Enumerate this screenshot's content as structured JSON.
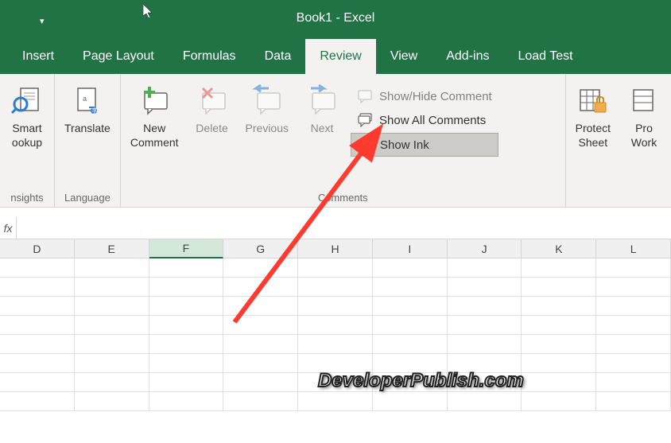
{
  "titlebar": {
    "title": "Book1  -  Excel"
  },
  "tabs": {
    "items": [
      {
        "label": "Insert"
      },
      {
        "label": "Page Layout"
      },
      {
        "label": "Formulas"
      },
      {
        "label": "Data"
      },
      {
        "label": "Review"
      },
      {
        "label": "View"
      },
      {
        "label": "Add-ins"
      },
      {
        "label": "Load Test"
      }
    ],
    "active_index": 4
  },
  "ribbon": {
    "groups": {
      "insights": {
        "label": "nsights",
        "smart_lookup": "Smart\nookup"
      },
      "language": {
        "label": "Language",
        "translate": "Translate"
      },
      "comments": {
        "label": "Comments",
        "new_comment": "New\nComment",
        "delete": "Delete",
        "previous": "Previous",
        "next": "Next",
        "show_hide": "Show/Hide Comment",
        "show_all": "Show All Comments",
        "show_ink": "Show Ink"
      },
      "changes": {
        "protect_sheet": "Protect\nSheet",
        "protect_workbook": "Pro\nWork"
      }
    }
  },
  "formula_bar": {
    "fx_label": "fx",
    "value": ""
  },
  "grid": {
    "columns": [
      "D",
      "E",
      "F",
      "G",
      "H",
      "I",
      "J",
      "K",
      "L"
    ],
    "selected_column": "F",
    "rows": 8
  },
  "watermark": "DeveloperPublish.com"
}
